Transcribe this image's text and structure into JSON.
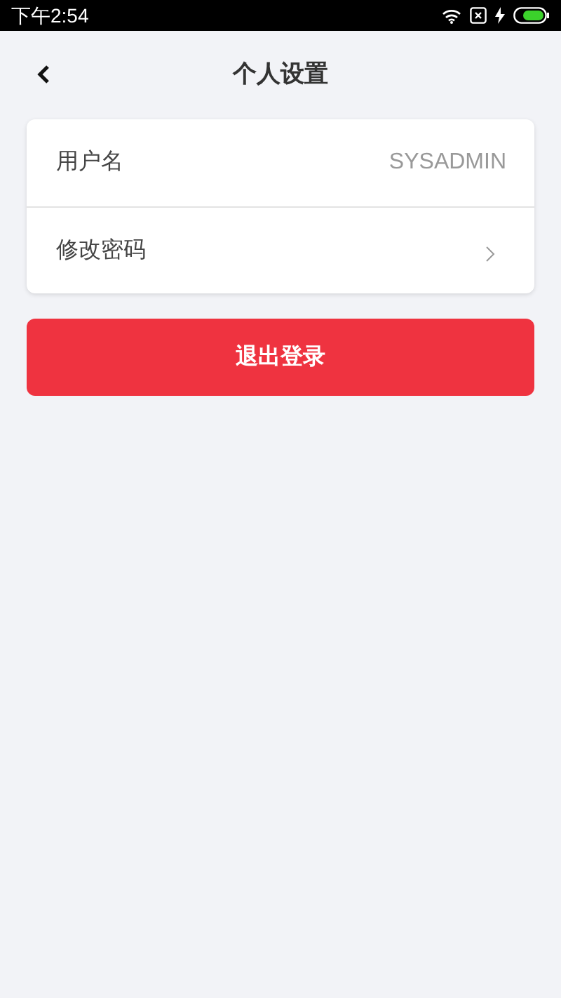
{
  "status_bar": {
    "time": "下午2:54"
  },
  "header": {
    "title": "个人设置"
  },
  "settings": [
    {
      "kind": "value",
      "label": "用户名",
      "value": "SYSADMIN"
    },
    {
      "kind": "link",
      "label": "修改密码"
    }
  ],
  "logout_button": {
    "label": "退出登录"
  }
}
